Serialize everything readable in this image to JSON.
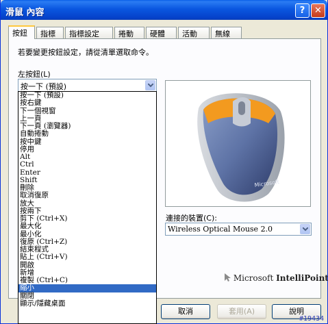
{
  "window": {
    "title": "滑鼠 內容",
    "help_glyph": "?",
    "close_glyph": "✕"
  },
  "tabs": [
    {
      "label": "按鈕"
    },
    {
      "label": "指標"
    },
    {
      "label": "指標設定"
    },
    {
      "label": "捲動"
    },
    {
      "label": "硬體"
    },
    {
      "label": "活動"
    },
    {
      "label": "無線"
    }
  ],
  "active_tab": "按鈕",
  "instruction": "若要變更按鈕設定，請從清單選取命令。",
  "left_button": {
    "label": "左按鈕(L)",
    "value": "按一下 (預設)",
    "options": [
      "按一下 (預設)",
      "按右鍵",
      "下一個視窗",
      "上一頁",
      "下一頁 (瀏覽器)",
      "自動捲動",
      "按中鍵",
      "停用",
      "Alt",
      "Ctrl",
      "Enter",
      "Shift",
      "刪除",
      "取消復原",
      "放大",
      "按兩下",
      "剪下 (Ctrl+X)",
      "最大化",
      "最小化",
      "復原 (Ctrl+Z)",
      "結束程式",
      "貼上 (Ctrl+V)",
      "開啟",
      "新增",
      "複製 (Ctrl+C)",
      "縮小",
      "關閉",
      "顯示/隱藏桌面"
    ],
    "highlighted": "縮小"
  },
  "device": {
    "label": "連接的裝置(C):",
    "value": "Wireless Optical Mouse 2.0"
  },
  "brand": {
    "prefix": "Microsoft",
    "product": "IntelliPoint"
  },
  "buttons": {
    "cancel": "取消",
    "apply": "套用(A)",
    "help": "說明"
  },
  "watermark": "#19434",
  "colors": {
    "titlebar": "#0a57e0",
    "selection": "#316ac5",
    "active_tab_accent": "#ffc83c"
  }
}
